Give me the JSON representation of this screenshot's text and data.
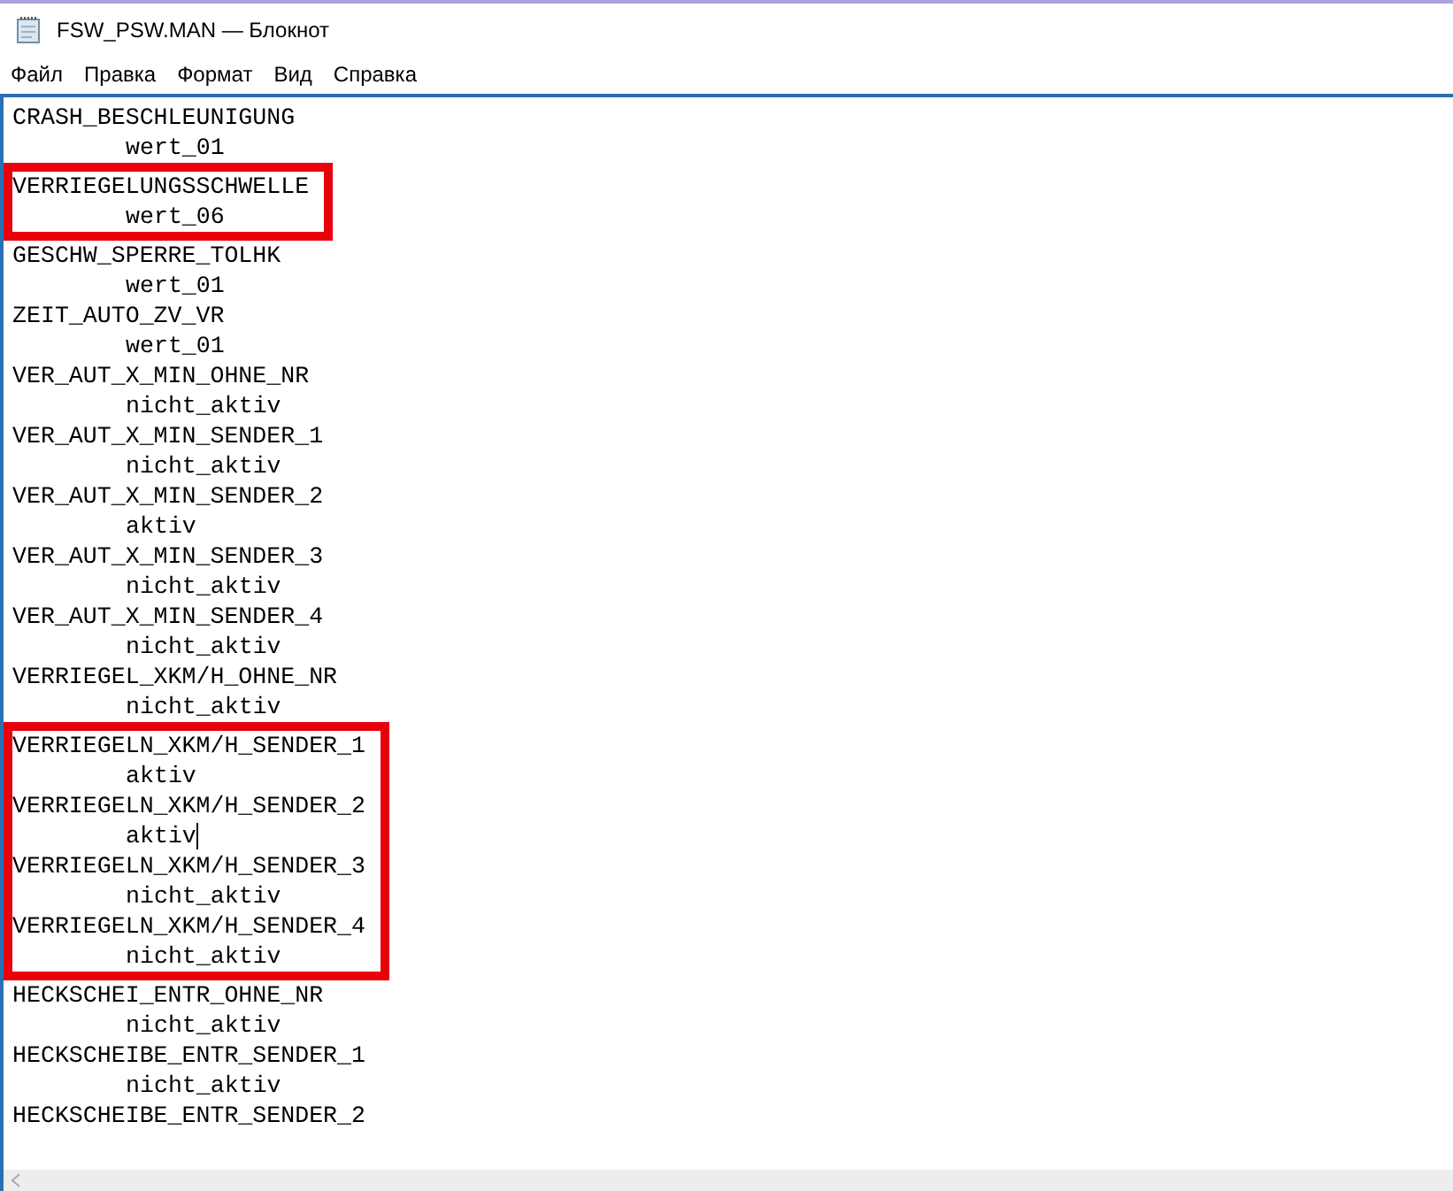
{
  "window": {
    "title": "FSW_PSW.MAN — Блокнот"
  },
  "menu": [
    "Файл",
    "Правка",
    "Формат",
    "Вид",
    "Справка"
  ],
  "blocks": [
    {
      "highlighted": false,
      "entries": [
        {
          "name": "CRASH_BESCHLEUNIGUNG",
          "value": "wert_01"
        }
      ]
    },
    {
      "highlighted": true,
      "entries": [
        {
          "name": "VERRIEGELUNGSSCHWELLE",
          "value": "wert_06"
        }
      ]
    },
    {
      "highlighted": false,
      "entries": [
        {
          "name": "GESCHW_SPERRE_TOLHK",
          "value": "wert_01"
        },
        {
          "name": "ZEIT_AUTO_ZV_VR",
          "value": "wert_01"
        },
        {
          "name": "VER_AUT_X_MIN_OHNE_NR",
          "value": "nicht_aktiv"
        },
        {
          "name": "VER_AUT_X_MIN_SENDER_1",
          "value": "nicht_aktiv"
        },
        {
          "name": "VER_AUT_X_MIN_SENDER_2",
          "value": "aktiv"
        },
        {
          "name": "VER_AUT_X_MIN_SENDER_3",
          "value": "nicht_aktiv"
        },
        {
          "name": "VER_AUT_X_MIN_SENDER_4",
          "value": "nicht_aktiv"
        },
        {
          "name": "VERRIEGEL_XKM/H_OHNE_NR",
          "value": "nicht_aktiv"
        }
      ]
    },
    {
      "highlighted": true,
      "entries": [
        {
          "name": "VERRIEGELN_XKM/H_SENDER_1",
          "value": "aktiv"
        },
        {
          "name": "VERRIEGELN_XKM/H_SENDER_2",
          "value": "aktiv",
          "cursor": true
        },
        {
          "name": "VERRIEGELN_XKM/H_SENDER_3",
          "value": "nicht_aktiv"
        },
        {
          "name": "VERRIEGELN_XKM/H_SENDER_4",
          "value": "nicht_aktiv"
        }
      ]
    },
    {
      "highlighted": false,
      "entries": [
        {
          "name": "HECKSCHEI_ENTR_OHNE_NR",
          "value": "nicht_aktiv"
        },
        {
          "name": "HECKSCHEIBE_ENTR_SENDER_1",
          "value": "nicht_aktiv"
        },
        {
          "name": "HECKSCHEIBE_ENTR_SENDER_2"
        }
      ]
    }
  ]
}
